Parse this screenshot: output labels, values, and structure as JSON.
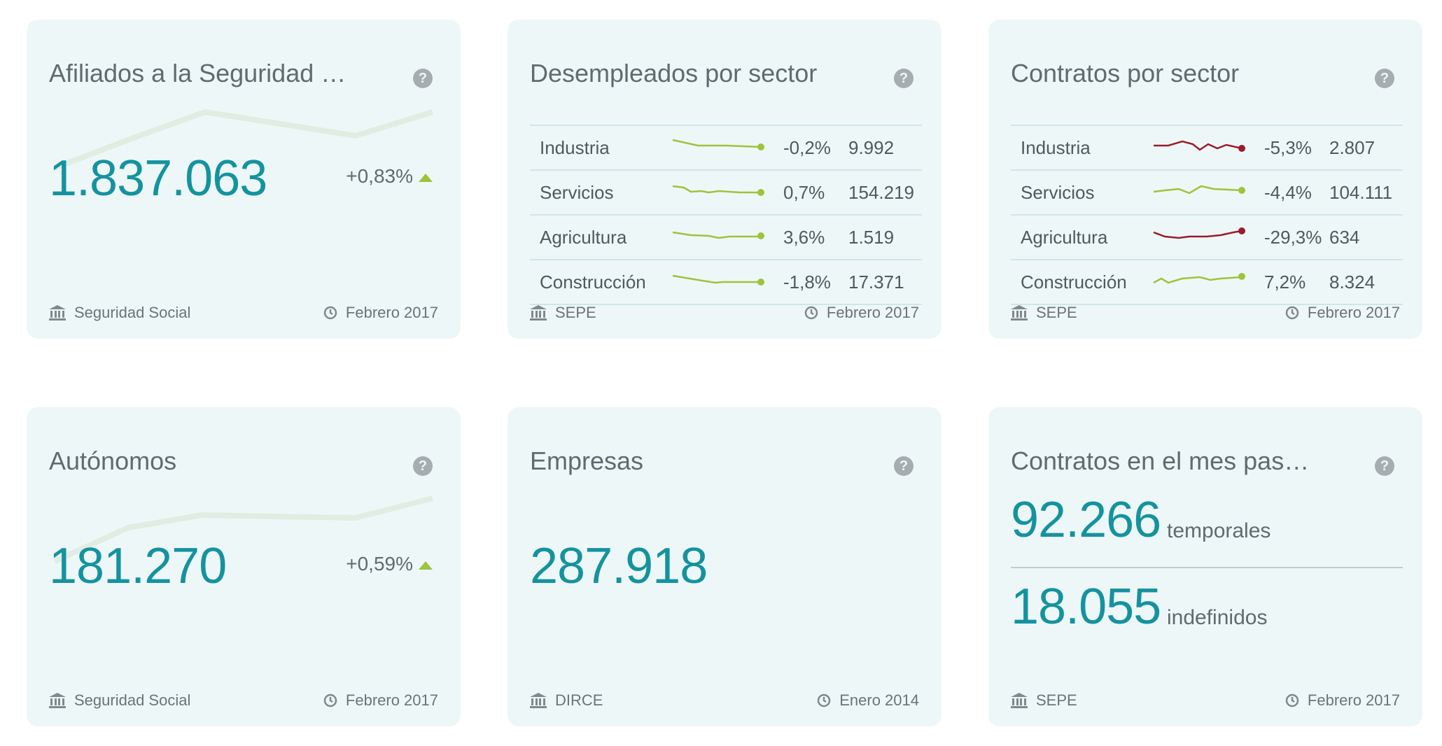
{
  "cards": {
    "afiliados": {
      "title": "Afiliados a la Seguridad S…",
      "value": "1.837.063",
      "change": "+0,83%",
      "source": "Seguridad Social",
      "date": "Febrero 2017"
    },
    "desempleados": {
      "title": "Desempleados por sector",
      "rows": [
        {
          "name": "Industria",
          "pct": "-0,2%",
          "value": "9.992"
        },
        {
          "name": "Servicios",
          "pct": "0,7%",
          "value": "154.219"
        },
        {
          "name": "Agricultura",
          "pct": "3,6%",
          "value": "1.519"
        },
        {
          "name": "Construcción",
          "pct": "-1,8%",
          "value": "17.371"
        }
      ],
      "source": "SEPE",
      "date": "Febrero 2017"
    },
    "contratos": {
      "title": "Contratos por sector",
      "rows": [
        {
          "name": "Industria",
          "pct": "-5,3%",
          "value": "2.807"
        },
        {
          "name": "Servicios",
          "pct": "-4,4%",
          "value": "104.111"
        },
        {
          "name": "Agricultura",
          "pct": "-29,3%",
          "value": "634"
        },
        {
          "name": "Construcción",
          "pct": "7,2%",
          "value": "8.324"
        }
      ],
      "source": "SEPE",
      "date": "Febrero 2017"
    },
    "autonomos": {
      "title": "Autónomos",
      "value": "181.270",
      "change": "+0,59%",
      "source": "Seguridad Social",
      "date": "Febrero 2017"
    },
    "empresas": {
      "title": "Empresas",
      "value": "287.918",
      "source": "DIRCE",
      "date": "Enero 2014"
    },
    "contratos_mes": {
      "title": "Contratos en el mes pasado",
      "temporales_value": "92.266",
      "temporales_label": "temporales",
      "indefinidos_value": "18.055",
      "indefinidos_label": "indefinidos",
      "source": "SEPE",
      "date": "Febrero 2017"
    }
  },
  "colors": {
    "accent": "#14939f",
    "up": "#9cc43c",
    "down": "#9b1c2c",
    "card_bg": "#eef7f8"
  },
  "icons": {
    "help": "question-icon",
    "source": "bank-icon",
    "date": "clock-icon",
    "trend_up": "triangle-up-icon"
  }
}
